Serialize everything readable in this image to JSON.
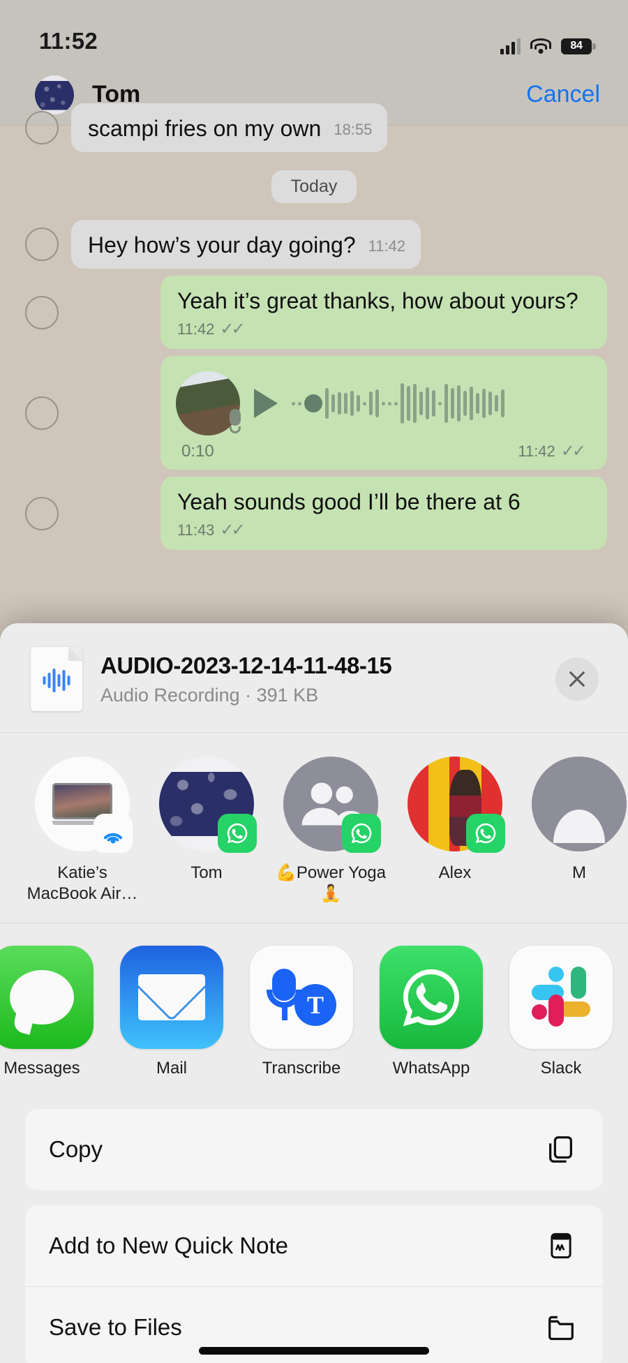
{
  "status_bar": {
    "time": "11:52",
    "battery_level": "84",
    "signal_icon": "cellular-bars-icon",
    "wifi_icon": "wifi-icon",
    "battery_icon": "battery-icon"
  },
  "chat_header": {
    "contact_name": "Tom",
    "cancel_label": "Cancel",
    "avatar_name": "contact-avatar-tom"
  },
  "conversation": {
    "day_separator": "Today",
    "messages": [
      {
        "text": "scampi fries on my own",
        "time": "18:55",
        "side": "in",
        "status": ""
      },
      {
        "text": "Hey how’s your day going?",
        "time": "11:42",
        "side": "in",
        "status": ""
      },
      {
        "text": "Yeah it’s great thanks, how about yours?",
        "time": "11:42",
        "side": "out",
        "status": "✓✓"
      },
      {
        "text": "",
        "time": "11:42",
        "side": "out",
        "status": "✓✓",
        "type": "voice",
        "duration": "0:10"
      },
      {
        "text": "Yeah sounds good I’ll be there at 6",
        "time": "11:43",
        "side": "out",
        "status": "✓✓"
      }
    ]
  },
  "share_sheet": {
    "file": {
      "name": "AUDIO-2023-12-14-11-48-15",
      "subtitle": "Audio Recording · 391 KB",
      "icon": "audio-file-icon",
      "close_icon": "close-icon"
    },
    "contacts": [
      {
        "label": "Katie’s MacBook Air…",
        "avatar": "macbook-avatar",
        "badge": "airdrop-badge-icon"
      },
      {
        "label": "Tom",
        "avatar": "contact-avatar-tom",
        "badge": "whatsapp-badge-icon"
      },
      {
        "label": "💪Power Yoga🧘",
        "avatar": "group-avatar",
        "badge": "whatsapp-badge-icon"
      },
      {
        "label": "Alex",
        "avatar": "contact-avatar-alex",
        "badge": "whatsapp-badge-icon"
      },
      {
        "label": "M",
        "avatar": "contact-avatar-partial",
        "badge": ""
      }
    ],
    "apps": [
      {
        "label": "Messages",
        "icon": "messages-app-icon"
      },
      {
        "label": "Mail",
        "icon": "mail-app-icon"
      },
      {
        "label": "Transcribe",
        "icon": "transcribe-app-icon"
      },
      {
        "label": "WhatsApp",
        "icon": "whatsapp-app-icon"
      },
      {
        "label": "Slack",
        "icon": "slack-app-icon"
      }
    ],
    "actions": [
      {
        "label": "Copy",
        "icon": "copy-icon"
      },
      {
        "label": "Add to New Quick Note",
        "icon": "quick-note-icon"
      },
      {
        "label": "Save to Files",
        "icon": "folder-icon"
      }
    ]
  },
  "colors": {
    "accent_blue": "#1672f0",
    "whatsapp_green": "#25d366",
    "outgoing_bubble": "#c5e2b3",
    "incoming_bubble": "#dcdcdc",
    "chat_background": "#cfc5ba",
    "sheet_background": "#ececec"
  }
}
